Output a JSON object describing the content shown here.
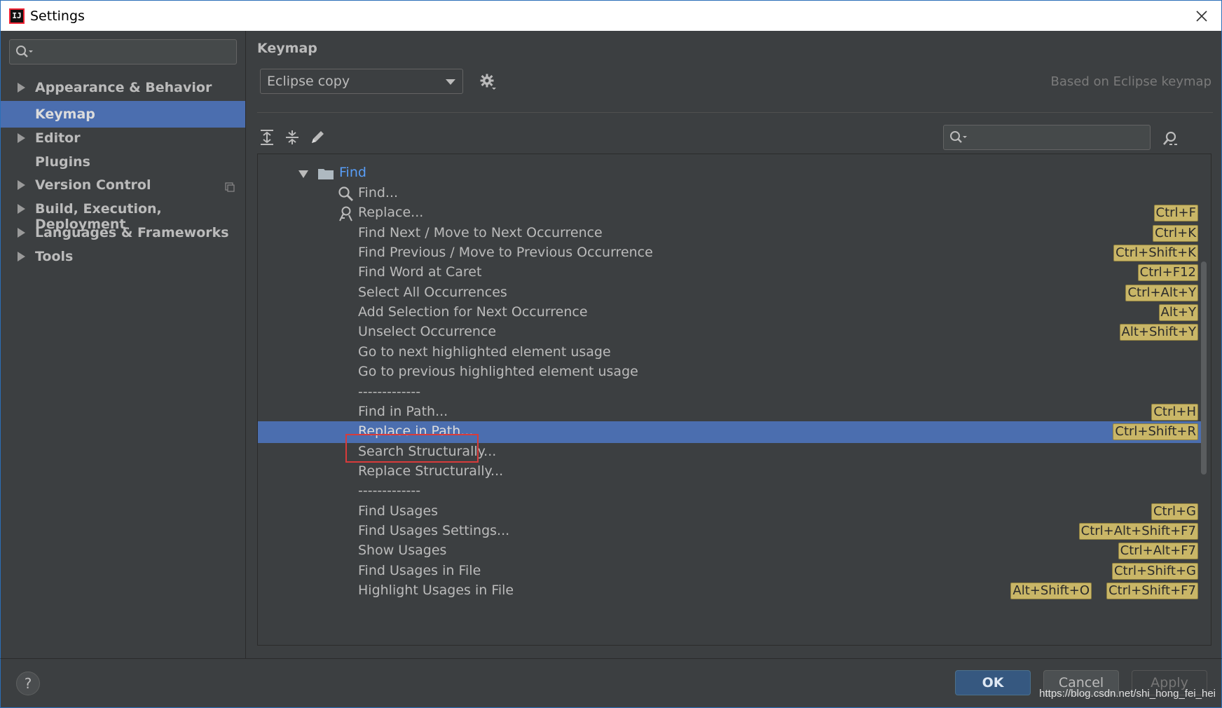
{
  "window": {
    "title": "Settings",
    "app_icon_text": "IJ"
  },
  "sidebar": {
    "search_placeholder": "",
    "items": [
      {
        "label": "Appearance & Behavior",
        "expandable": true
      },
      {
        "label": "Keymap",
        "expandable": false,
        "selected": true
      },
      {
        "label": "Editor",
        "expandable": true
      },
      {
        "label": "Plugins",
        "expandable": false
      },
      {
        "label": "Version Control",
        "expandable": true
      },
      {
        "label": "Build, Execution, Deployment",
        "expandable": true
      },
      {
        "label": "Languages & Frameworks",
        "expandable": true
      },
      {
        "label": "Tools",
        "expandable": true
      }
    ]
  },
  "main": {
    "title": "Keymap",
    "keymap_value": "Eclipse copy",
    "based_on": "Based on Eclipse keymap",
    "tree": {
      "folder": "Find",
      "rows": [
        {
          "text": "Find...",
          "icon": "search-icon",
          "shortcuts": []
        },
        {
          "text": "Replace...",
          "icon": "replace-icon",
          "shortcuts": [
            "Ctrl+F"
          ]
        },
        {
          "text": "Find Next / Move to Next Occurrence",
          "shortcuts": [
            "Ctrl+K"
          ]
        },
        {
          "text": "Find Previous / Move to Previous Occurrence",
          "shortcuts": [
            "Ctrl+Shift+K"
          ]
        },
        {
          "text": "Find Word at Caret",
          "shortcuts": [
            "Ctrl+F12"
          ]
        },
        {
          "text": "Select All Occurrences",
          "shortcuts": [
            "Ctrl+Alt+Y"
          ]
        },
        {
          "text": "Add Selection for Next Occurrence",
          "shortcuts": [
            "Alt+Y"
          ]
        },
        {
          "text": "Unselect Occurrence",
          "shortcuts": [
            "Alt+Shift+Y"
          ]
        },
        {
          "text": "Go to next highlighted element usage",
          "shortcuts": []
        },
        {
          "text": "Go to previous highlighted element usage",
          "shortcuts": []
        },
        {
          "text": "-------------",
          "shortcuts": []
        },
        {
          "text": "Find in Path...",
          "shortcuts": [
            "Ctrl+H"
          ]
        },
        {
          "text": "Replace in Path...",
          "shortcuts": [
            "Ctrl+Shift+R"
          ],
          "selected": true
        },
        {
          "text": "Search Structurally...",
          "shortcuts": []
        },
        {
          "text": "Replace Structurally...",
          "shortcuts": []
        },
        {
          "text": "-------------",
          "shortcuts": []
        },
        {
          "text": "Find Usages",
          "shortcuts": [
            "Ctrl+G"
          ]
        },
        {
          "text": "Find Usages Settings...",
          "shortcuts": [
            "Ctrl+Alt+Shift+F7"
          ]
        },
        {
          "text": "Show Usages",
          "shortcuts": [
            "Ctrl+Alt+F7"
          ]
        },
        {
          "text": "Find Usages in File",
          "shortcuts": [
            "Ctrl+Shift+G"
          ]
        },
        {
          "text": "Highlight Usages in File",
          "shortcuts": [
            "Alt+Shift+O",
            "Ctrl+Shift+F7"
          ]
        }
      ]
    }
  },
  "footer": {
    "help_label": "?",
    "ok_label": "OK",
    "cancel_label": "Cancel",
    "apply_label": "Apply",
    "watermark": "https://blog.csdn.net/shi_hong_fei_hei"
  },
  "colors": {
    "background": "#3c3f41",
    "selection": "#4b6eaf",
    "shortcut_badge": "#c9b667",
    "link_blue": "#589df6"
  }
}
